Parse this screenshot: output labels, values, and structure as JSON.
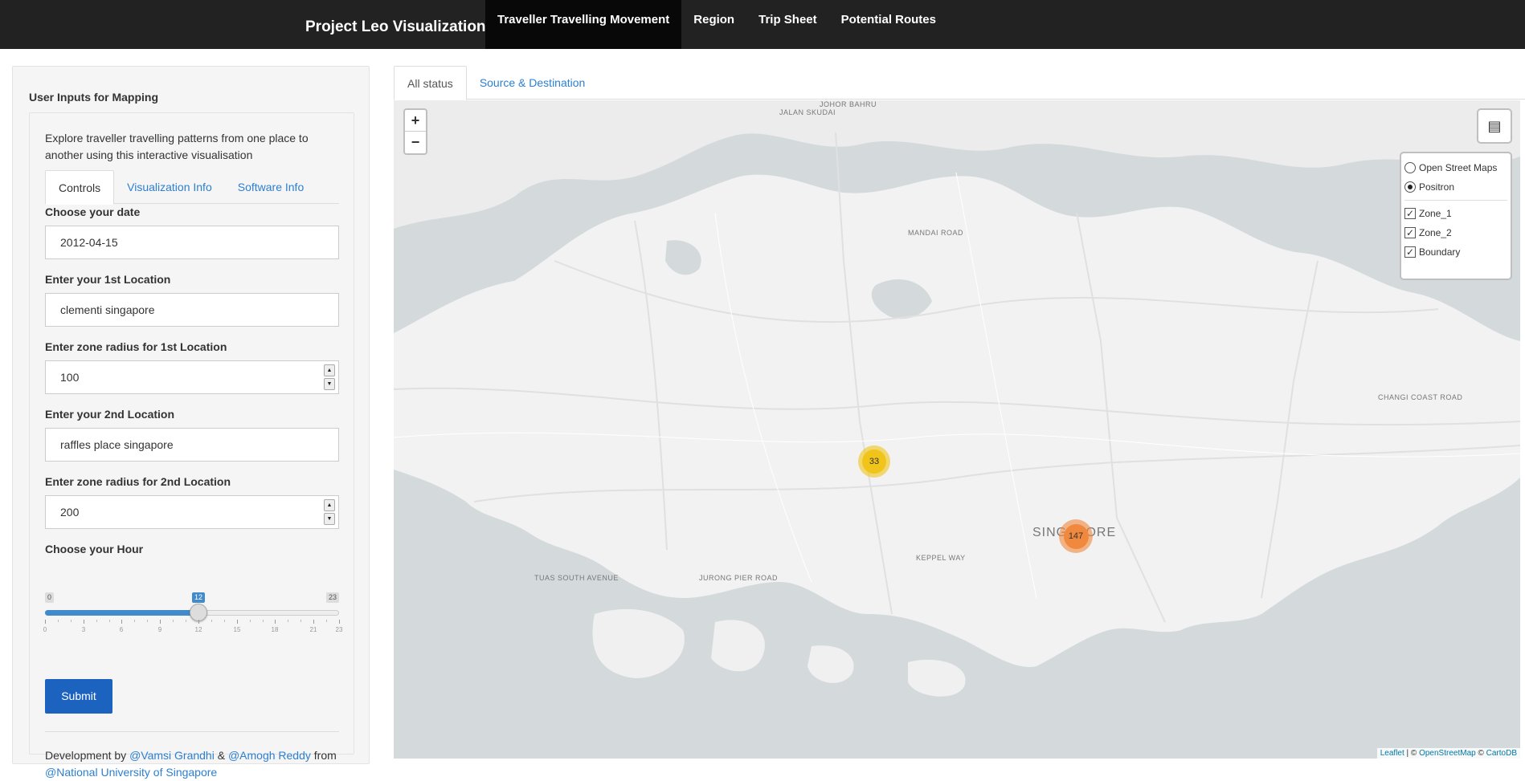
{
  "navbar": {
    "brand": "Project Leo Visualization",
    "items": [
      {
        "label": "Traveller Travelling Movement",
        "active": true
      },
      {
        "label": "Region",
        "active": false
      },
      {
        "label": "Trip Sheet",
        "active": false
      },
      {
        "label": "Potential Routes",
        "active": false
      }
    ]
  },
  "sidebar": {
    "title": "User Inputs for Mapping",
    "intro": "Explore traveller travelling patterns from one place to another using this interactive visualisation",
    "tabs": [
      "Controls",
      "Visualization Info",
      "Software Info"
    ],
    "date_label": "Choose your date",
    "date_value": "2012-04-15",
    "loc1_label": "Enter your 1st Location",
    "loc1_value": "clementi singapore",
    "radius1_label": "Enter zone radius for 1st Location",
    "radius1_value": "100",
    "loc2_label": "Enter your 2nd Location",
    "loc2_value": "raffles place singapore",
    "radius2_label": "Enter zone radius for 2nd Location",
    "radius2_value": "200",
    "hour_label": "Choose your Hour",
    "hour_min": "0",
    "hour_max": "23",
    "hour_value": "12",
    "hour_value_num": 12,
    "hour_ticks": [
      "0",
      "3",
      "6",
      "9",
      "12",
      "15",
      "18",
      "21",
      "23"
    ],
    "submit_label": "Submit",
    "credits": {
      "prefix": "Development by ",
      "author1": "@Vamsi Grandhi",
      "amp": " & ",
      "author2": "@Amogh Reddy",
      "from": " from",
      "org": "@National University of Singapore"
    }
  },
  "main": {
    "tabs": [
      "All status",
      "Source & Destination"
    ]
  },
  "map": {
    "zoom_in": "+",
    "zoom_out": "−",
    "layers": {
      "base": [
        {
          "label": "Open Street Maps",
          "checked": false
        },
        {
          "label": "Positron",
          "checked": true
        }
      ],
      "overlays": [
        {
          "label": "Zone_1",
          "checked": true
        },
        {
          "label": "Zone_2",
          "checked": true
        },
        {
          "label": "Boundary",
          "checked": true
        }
      ]
    },
    "clusters": [
      {
        "count": "33",
        "color": "#f0c419"
      },
      {
        "count": "147",
        "color": "#f0883e"
      }
    ],
    "place_labels": [
      "JOHOR BAHRU",
      "SINGAPORE",
      "MANDAI ROAD",
      "KEPPEL WAY",
      "JURONG PIER ROAD",
      "TUAS SOUTH AVENUE",
      "CHANGI COAST ROAD",
      "JALAN SKUDAI"
    ],
    "attribution": {
      "leaflet": "Leaflet",
      "sep1": " | © ",
      "osm": "OpenStreetMap",
      "sep2": " © ",
      "carto": "CartoDB"
    }
  },
  "colors": {
    "navbar": "#222222",
    "link": "#2c7fd1",
    "button": "#1c63c0",
    "slider": "#428bca",
    "water": "#d4dadc",
    "land": "#f2f2f2"
  }
}
